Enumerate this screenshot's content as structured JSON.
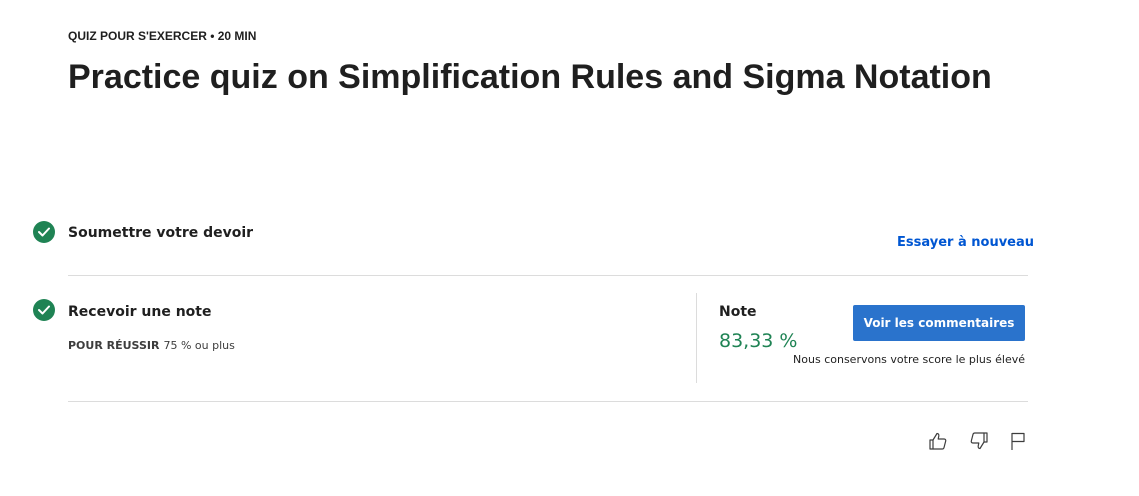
{
  "header": {
    "meta": "QUIZ POUR S'EXERCER • 20  MIN",
    "title": "Practice quiz on Simplification Rules and Sigma Notation"
  },
  "steps": {
    "submit": {
      "label": "Soumettre votre devoir",
      "retry_link": "Essayer à nouveau"
    },
    "receive": {
      "label": "Recevoir une note",
      "pass_key": "POUR RÉUSSIR",
      "pass_value": "75 % ou plus"
    }
  },
  "grade": {
    "heading": "Note",
    "value": "83,33 %",
    "feedback_button": "Voir les commentaires",
    "note": "Nous conservons votre score le plus élevé"
  },
  "actions": {
    "like": "thumbs-up-icon",
    "dislike": "thumbs-down-icon",
    "report": "flag-icon"
  },
  "colors": {
    "success": "#1f8354",
    "link": "#0056d2",
    "button": "#2a73cc"
  }
}
